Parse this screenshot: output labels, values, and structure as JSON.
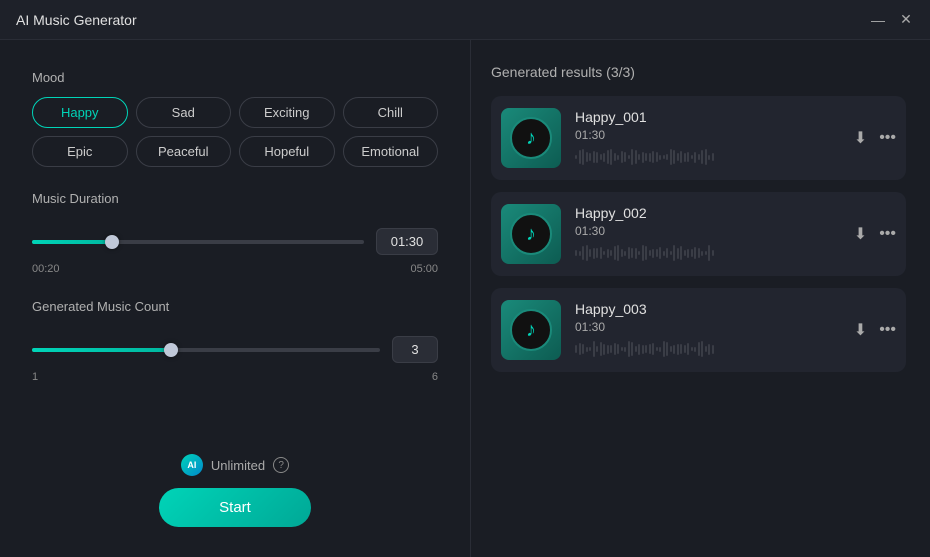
{
  "app": {
    "title": "AI Music Generator",
    "minimize_label": "—",
    "close_label": "✕"
  },
  "mood": {
    "label": "Mood",
    "buttons": [
      {
        "id": "happy",
        "label": "Happy",
        "active": true
      },
      {
        "id": "sad",
        "label": "Sad",
        "active": false
      },
      {
        "id": "exciting",
        "label": "Exciting",
        "active": false
      },
      {
        "id": "chill",
        "label": "Chill",
        "active": false
      },
      {
        "id": "epic",
        "label": "Epic",
        "active": false
      },
      {
        "id": "peaceful",
        "label": "Peaceful",
        "active": false
      },
      {
        "id": "hopeful",
        "label": "Hopeful",
        "active": false
      },
      {
        "id": "emotional",
        "label": "Emotional",
        "active": false
      }
    ]
  },
  "duration": {
    "label": "Music Duration",
    "min_label": "00:20",
    "max_label": "05:00",
    "value": "01:30",
    "fill_percent": 24
  },
  "count": {
    "label": "Generated Music Count",
    "min_label": "1",
    "max_label": "6",
    "value": "3",
    "fill_percent": 40
  },
  "unlimited": {
    "label": "Unlimited",
    "ai_label": "AI"
  },
  "start_button": "Start",
  "results": {
    "header": "Generated results (3/3)",
    "items": [
      {
        "title": "Happy_001",
        "duration": "01:30"
      },
      {
        "title": "Happy_002",
        "duration": "01:30"
      },
      {
        "title": "Happy_003",
        "duration": "01:30"
      }
    ]
  }
}
